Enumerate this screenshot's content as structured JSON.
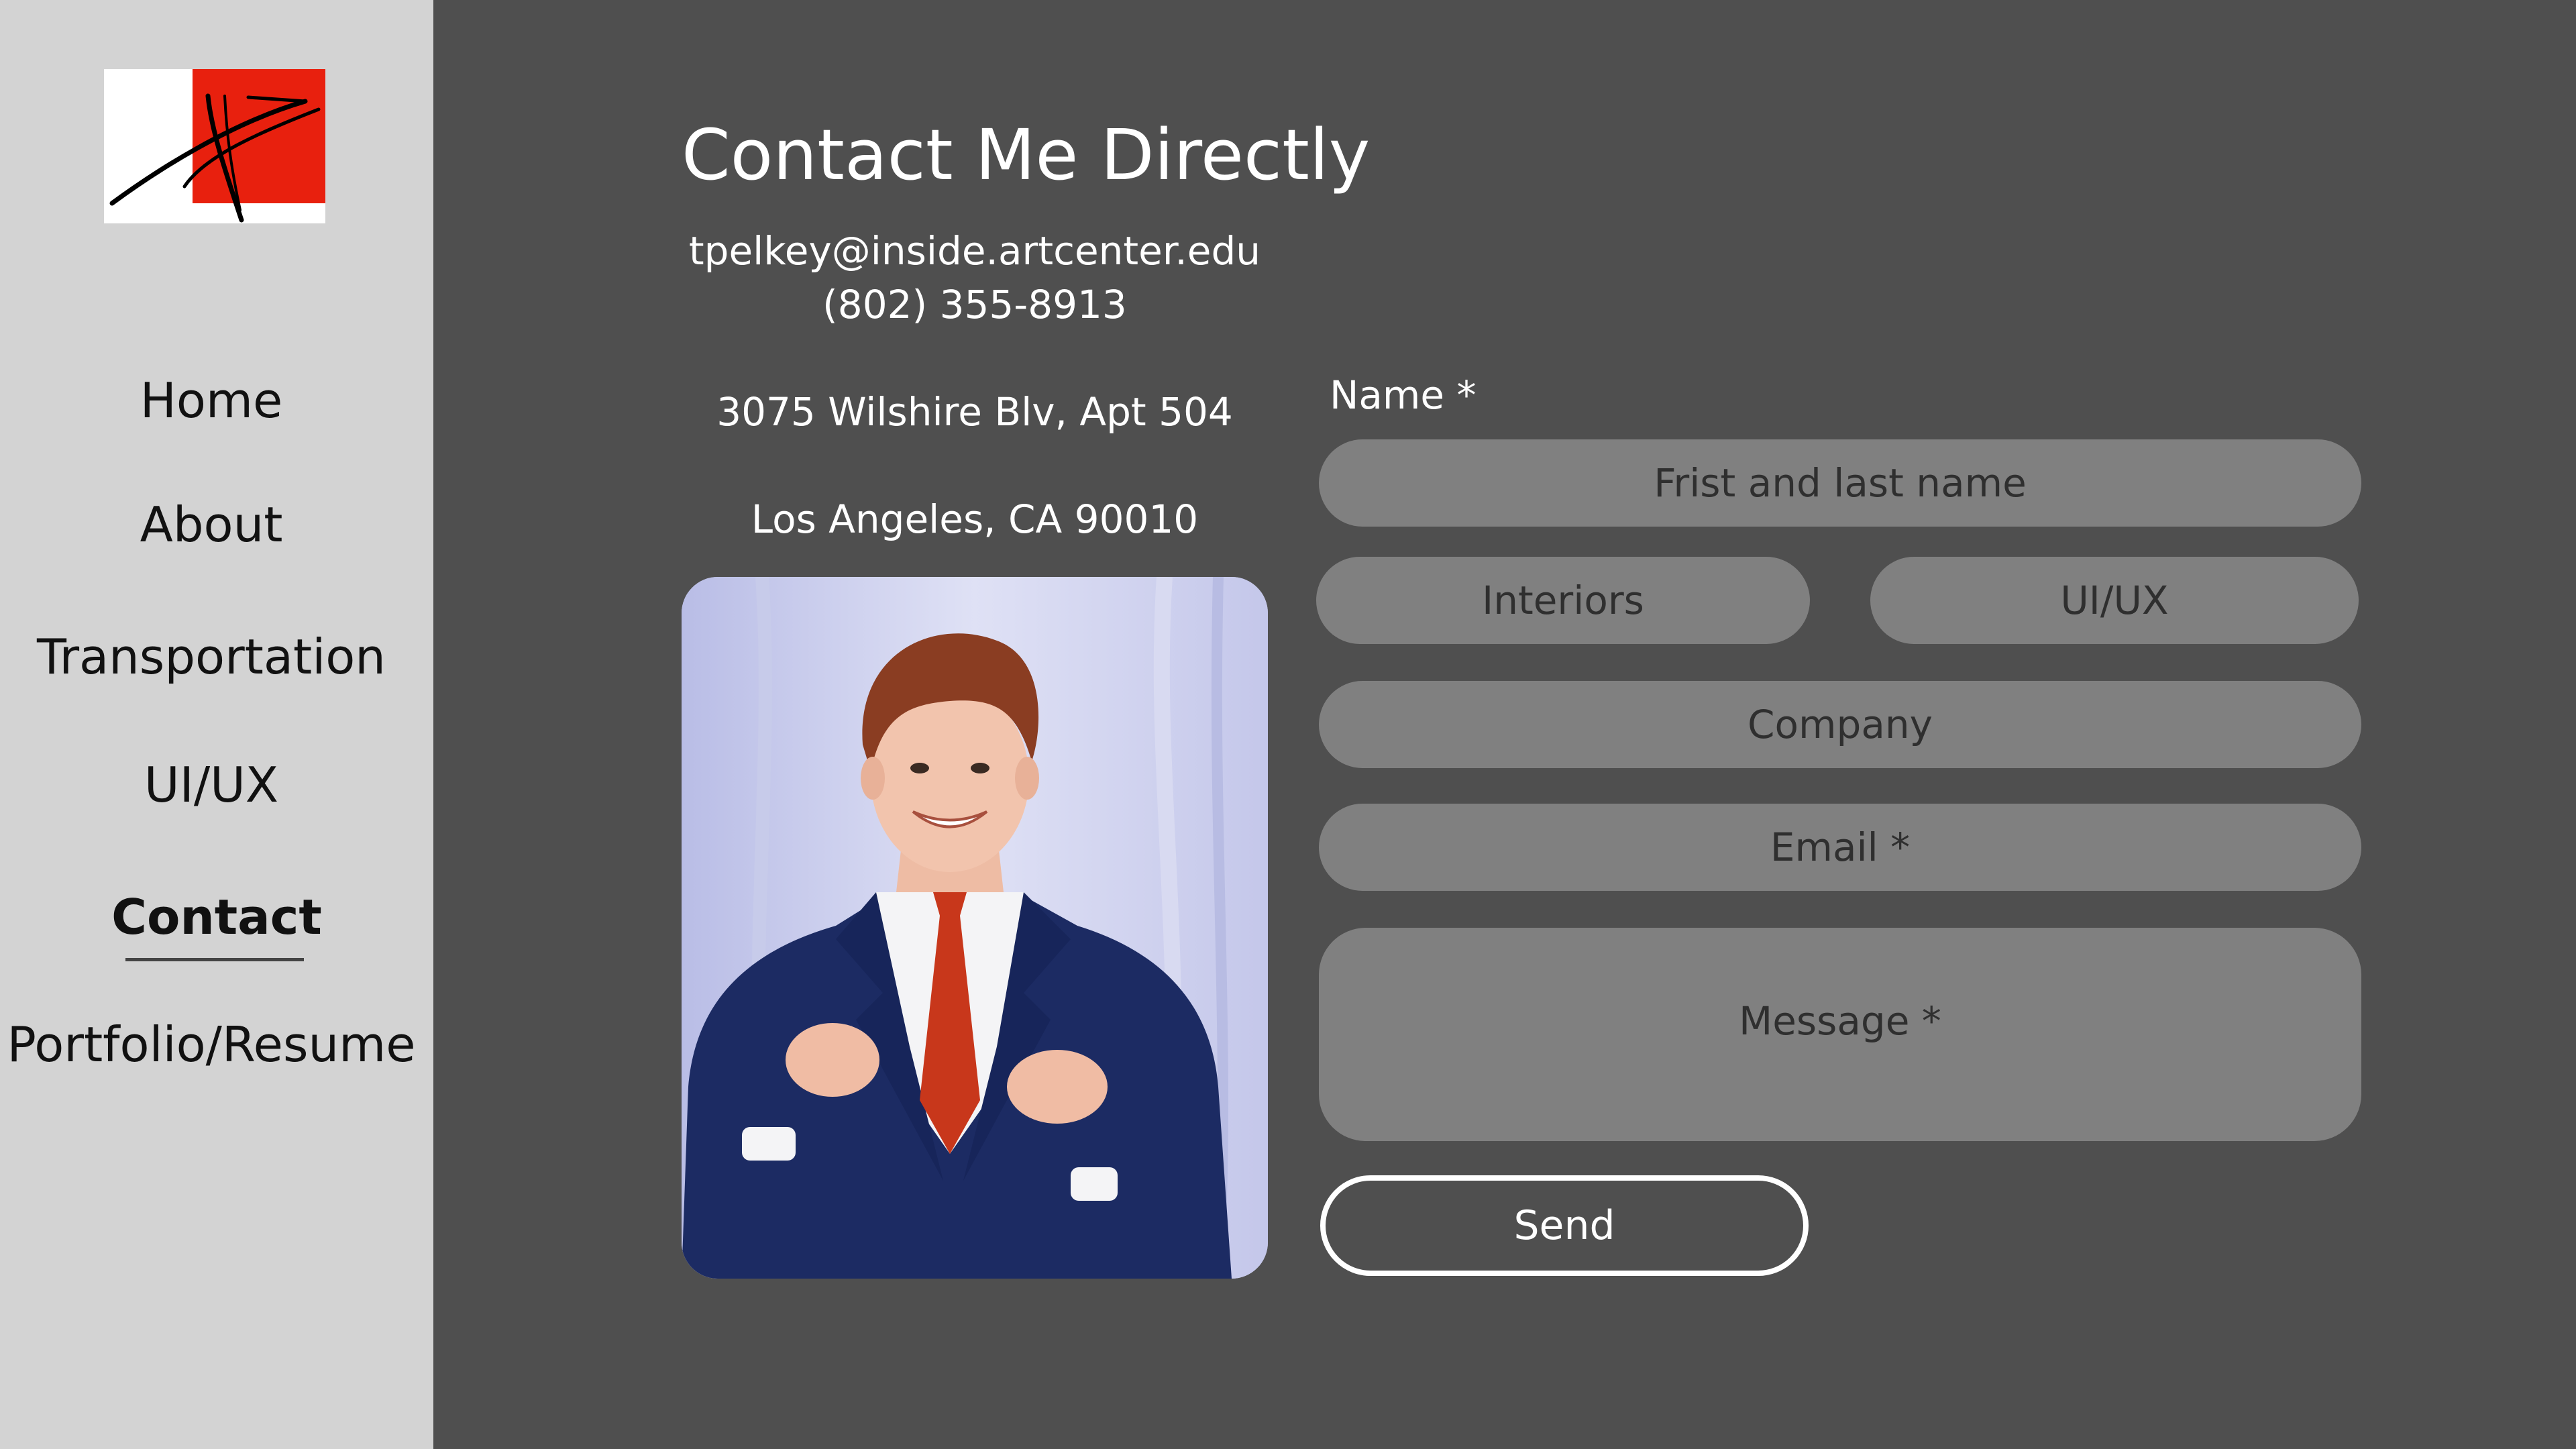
{
  "sidebar": {
    "logo_name": "logo-mark",
    "items": [
      {
        "label": "Home",
        "active": false
      },
      {
        "label": "About",
        "active": false
      },
      {
        "label": "Transportation",
        "active": false
      },
      {
        "label": "UI/UX",
        "active": false
      },
      {
        "label": "Contact",
        "active": true
      },
      {
        "label": "Portfolio/Resume",
        "active": false
      }
    ]
  },
  "main": {
    "title": "Contact Me Directly",
    "email": "tpelkey@inside.artcenter.edu",
    "phone": "(802) 355-8913",
    "address_line1": "3075 Wilshire Blv, Apt 504",
    "address_line2": "Los Angeles, CA 90010"
  },
  "form": {
    "name_label": "Name *",
    "name_placeholder": "Frist and last name",
    "interiors_placeholder": "Interiors",
    "uiux_placeholder": "UI/UX",
    "company_placeholder": "Company",
    "email_placeholder": "Email *",
    "message_placeholder": "Message *",
    "send_label": "Send"
  },
  "colors": {
    "sidebar_bg": "#d3d3d3",
    "main_bg": "#4f4f4f",
    "field_bg": "#808080",
    "logo_red": "#e8200e"
  }
}
